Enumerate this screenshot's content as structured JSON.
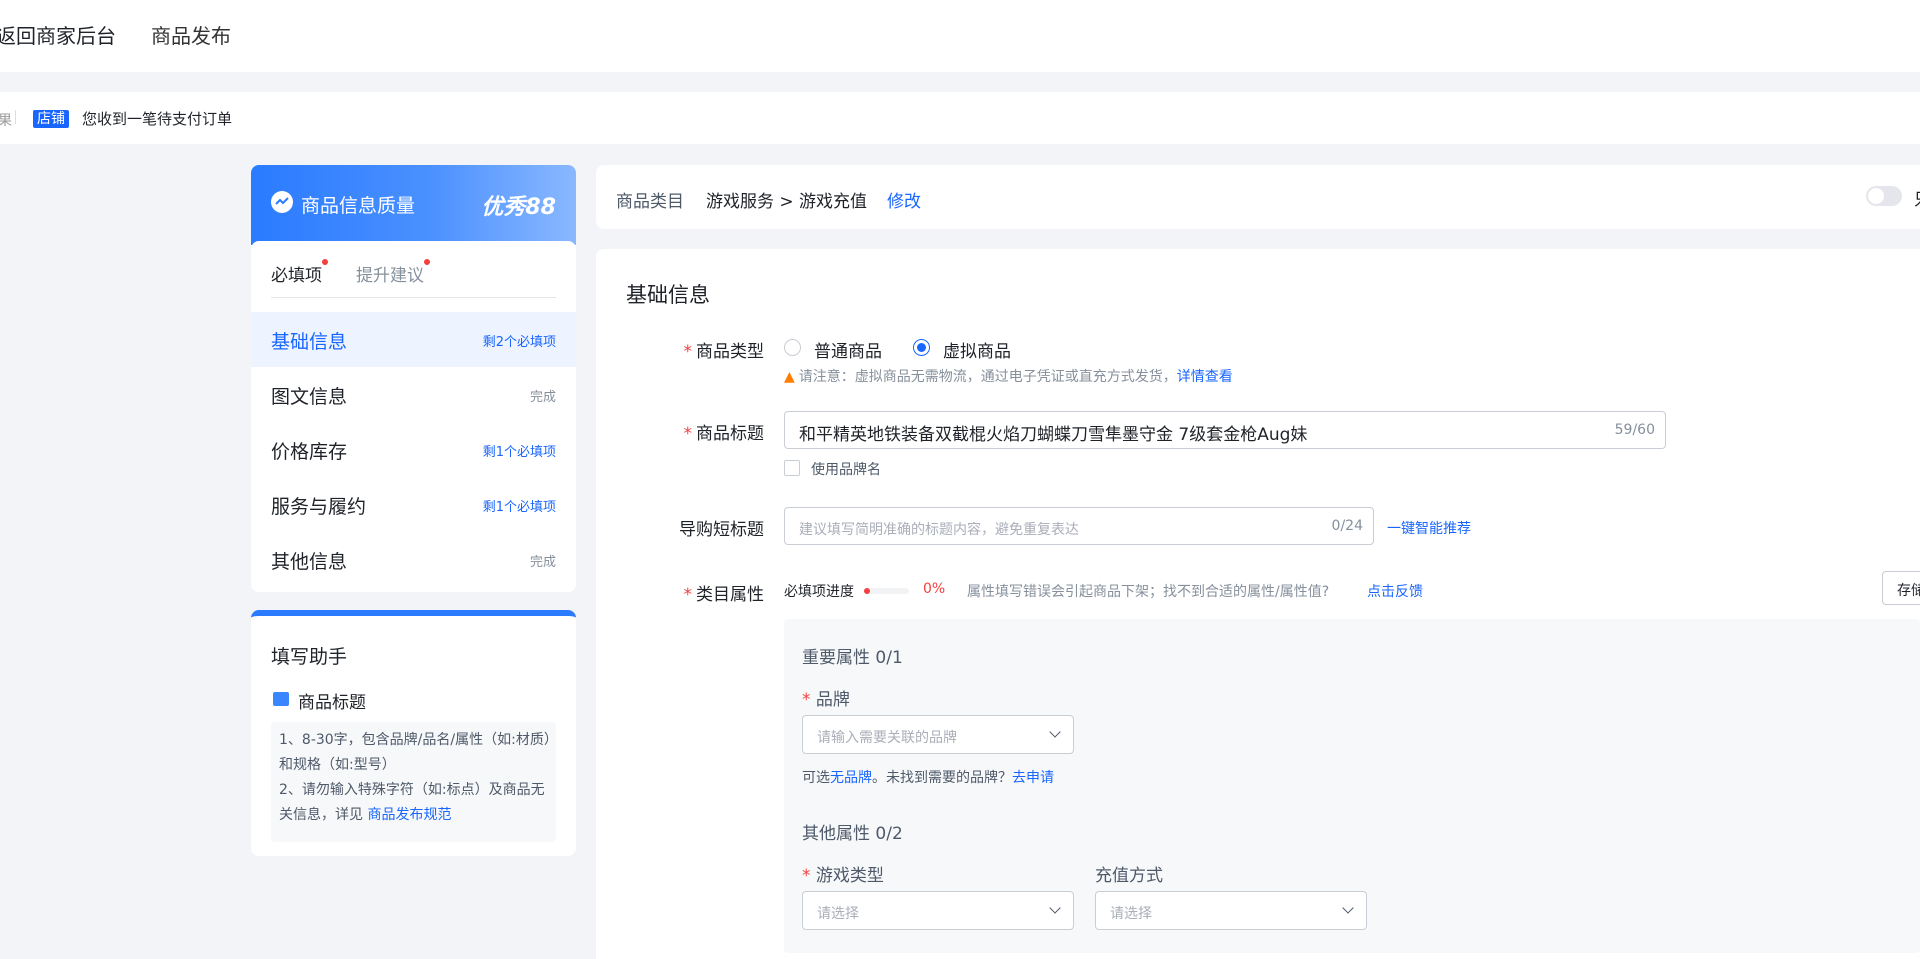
{
  "topbar": {
    "back_label": "返回商家后台",
    "crumb": "商品发布"
  },
  "notice": {
    "lead_char": "果",
    "shop_tag": "店铺",
    "message": "您收到一笔待支付订单"
  },
  "quality": {
    "title": "商品信息质量",
    "score": "优秀88",
    "tabs": [
      {
        "label": "必填项"
      },
      {
        "label": "提升建议"
      }
    ],
    "items": [
      {
        "label": "基础信息",
        "status": "剩2个必填项"
      },
      {
        "label": "图文信息",
        "status": "完成"
      },
      {
        "label": "价格库存",
        "status": "剩1个必填项"
      },
      {
        "label": "服务与履约",
        "status": "剩1个必填项"
      },
      {
        "label": "其他信息",
        "status": "完成"
      }
    ]
  },
  "helper": {
    "title": "填写助手",
    "subtitle": "商品标题",
    "tip1": "1、8-30字，包含品牌/品名/属性（如:材质）和规格（如:型号）",
    "tip2": "2、请勿输入特殊字符（如:标点）及商品无关信息，详见",
    "tip2_link": "商品发布规范"
  },
  "category": {
    "label": "商品类目",
    "value": "游戏服务 > 游戏充值",
    "edit": "修改",
    "toggle_label": "只"
  },
  "form": {
    "section_title": "基础信息",
    "type": {
      "label": "商品类型",
      "options": [
        {
          "label": "普通商品",
          "checked": false
        },
        {
          "label": "虚拟商品",
          "checked": true
        }
      ],
      "warning": "请注意：虚拟商品无需物流，通过电子凭证或直充方式发货，",
      "warning_link": "详情查看"
    },
    "title": {
      "label": "商品标题",
      "value": "和平精英地铁装备双截棍火焰刀蝴蝶刀雪隼墨守金 7级套金枪Aug妹",
      "counter": "59/60",
      "brand_checkbox": "使用品牌名"
    },
    "short_title": {
      "label": "导购短标题",
      "placeholder": "建议填写简明准确的标题内容，避免重复表达",
      "counter": "0/24",
      "smart": "一键智能推荐"
    },
    "attrs": {
      "label": "类目属性",
      "progress_label": "必填项进度",
      "progress_value": "0%",
      "progress_fraction": 0,
      "hint": "属性填写错误会引起商品下架；找不到合适的属性/属性值?",
      "feedback": "点击反馈",
      "save_btn": "存储",
      "important_title": "重要属性 0/1",
      "brand_label": "品牌",
      "brand_placeholder": "请输入需要关联的品牌",
      "brand_hint_pre": "可选",
      "brand_hint_link": "无品牌",
      "brand_hint_mid": "。未找到需要的品牌？",
      "brand_hint_apply": "去申请",
      "other_title": "其他属性 0/2",
      "game_type_label": "游戏类型",
      "game_type_placeholder": "请选择",
      "recharge_label": "充值方式",
      "recharge_placeholder": "请选择"
    }
  },
  "colors": {
    "accent": "#1966ff",
    "required": "#f53f3f",
    "warning": "#ff7d00"
  }
}
